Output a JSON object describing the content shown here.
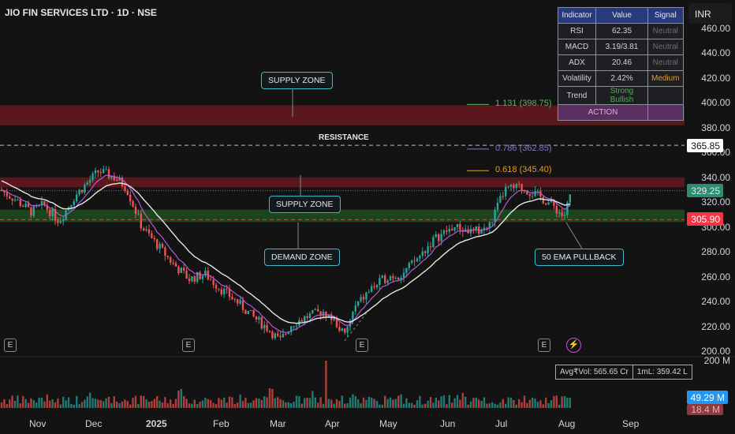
{
  "header": {
    "title": "JIO FIN SERVICES LTD · 1D · NSE",
    "currency": "INR"
  },
  "indicator_table": {
    "headers": [
      "Indicator",
      "Value",
      "Signal"
    ],
    "rows": [
      [
        "RSI",
        "62.35",
        "Neutral"
      ],
      [
        "MACD",
        "3.19/3.81",
        "Neutral"
      ],
      [
        "ADX",
        "20.46",
        "Neutral"
      ],
      [
        "Volatility",
        "2.42%",
        "Medium"
      ],
      [
        "Trend",
        "Strong Bullish",
        ""
      ]
    ],
    "action": "ACTION",
    "colors": {
      "neutral": "#6b6e76",
      "medium": "#e39b26",
      "bullish": "#4caf50"
    }
  },
  "annotations": {
    "supply_zone_top": "SUPPLY ZONE",
    "resistance": "RESISTANCE",
    "supply_zone_mid": "SUPPLY ZONE",
    "demand_zone": "DEMAND ZONE",
    "ema_pullback": "50 EMA PULLBACK"
  },
  "fib": [
    {
      "label": "1.131 (398.75)",
      "price": 398.75,
      "color": "#5fb35f"
    },
    {
      "label": "0.786 (362.85)",
      "price": 362.85,
      "color": "#7b7bc0"
    },
    {
      "label": "0.618 (345.40)",
      "price": 345.4,
      "color": "#e39b26"
    }
  ],
  "price_tags": {
    "resistance": "365.85",
    "last": "329.25",
    "ema": "305.90"
  },
  "volume": {
    "avg": "Avg₹Vol: 565.65 Cr",
    "one_ml": "1mL: 359.42 L",
    "axis_max": "200 M",
    "last_vol": "49.29 M",
    "avg_tag": "18.4 M"
  },
  "events": [
    "E",
    "E",
    "E",
    "E"
  ],
  "chart_data": {
    "type": "candlestick",
    "title": "JIO FIN SERVICES LTD · 1D · NSE",
    "ylim": [
      200,
      460
    ],
    "y_ticks": [
      "460.00",
      "440.00",
      "420.00",
      "400.00",
      "380.00",
      "360.00",
      "340.00",
      "320.00",
      "300.00",
      "280.00",
      "260.00",
      "240.00",
      "220.00",
      "200.00"
    ],
    "x_ticks": [
      "Nov",
      "Dec",
      "2025",
      "Feb",
      "Mar",
      "Apr",
      "May",
      "Jun",
      "Jul",
      "Aug",
      "Sep"
    ],
    "close_path": [
      [
        0,
        330
      ],
      [
        20,
        322
      ],
      [
        40,
        312
      ],
      [
        55,
        318
      ],
      [
        75,
        305
      ],
      [
        95,
        325
      ],
      [
        110,
        335
      ],
      [
        125,
        345
      ],
      [
        145,
        340
      ],
      [
        160,
        332
      ],
      [
        180,
        300
      ],
      [
        200,
        285
      ],
      [
        220,
        270
      ],
      [
        240,
        258
      ],
      [
        260,
        262
      ],
      [
        280,
        250
      ],
      [
        300,
        240
      ],
      [
        320,
        228
      ],
      [
        340,
        218
      ],
      [
        355,
        208
      ],
      [
        370,
        222
      ],
      [
        390,
        228
      ],
      [
        410,
        232
      ],
      [
        425,
        224
      ],
      [
        437,
        212
      ],
      [
        450,
        235
      ],
      [
        470,
        250
      ],
      [
        491,
        260
      ],
      [
        510,
        262
      ],
      [
        530,
        275
      ],
      [
        550,
        290
      ],
      [
        575,
        300
      ],
      [
        600,
        296
      ],
      [
        620,
        300
      ],
      [
        640,
        330
      ],
      [
        660,
        332
      ],
      [
        680,
        326
      ],
      [
        700,
        318
      ],
      [
        715,
        308
      ],
      [
        725,
        329.25
      ]
    ],
    "zones": [
      {
        "name": "supply",
        "from": 382,
        "to": 398
      },
      {
        "name": "supply",
        "from": 332,
        "to": 340
      },
      {
        "name": "demand",
        "from": 304,
        "to": 314
      }
    ],
    "resistance": 365.85
  }
}
